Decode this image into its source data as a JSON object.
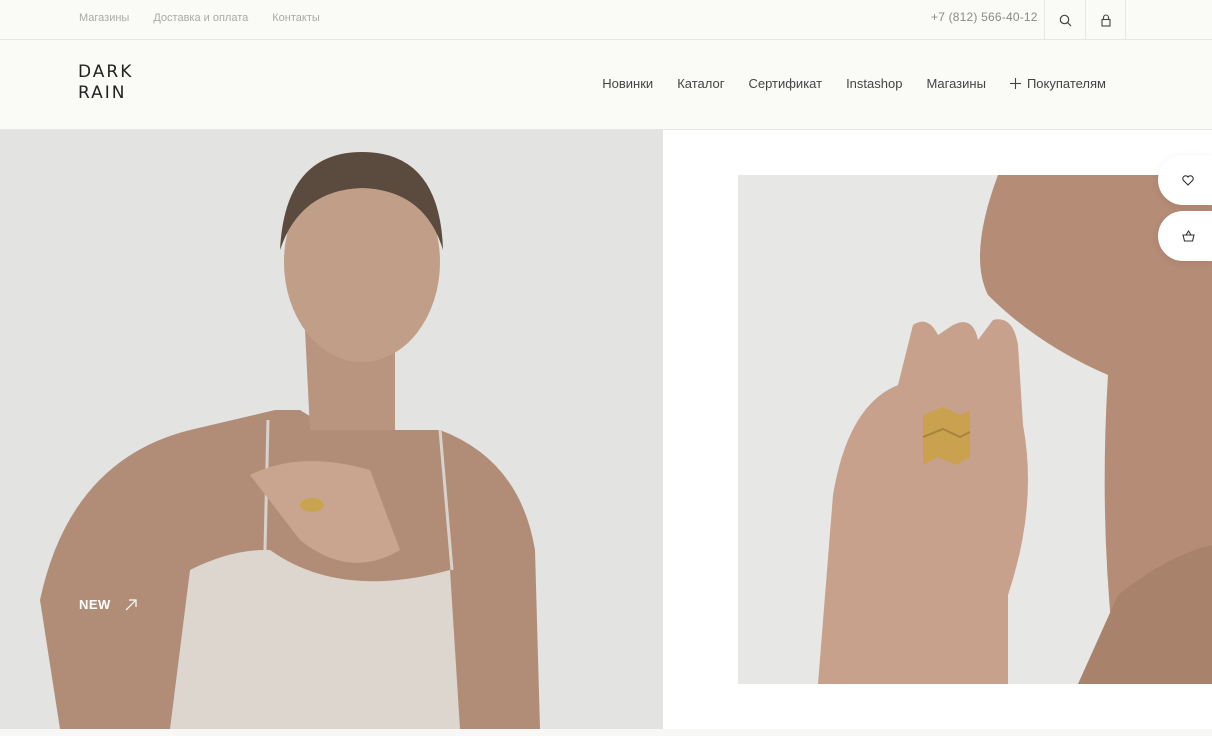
{
  "topbar": {
    "links": [
      "Магазины",
      "Доставка и оплата",
      "Контакты"
    ],
    "phone": "+7 (812) 566-40-12",
    "icons": {
      "search": "search-icon",
      "account": "user-icon"
    }
  },
  "header": {
    "logo": {
      "line1": "DARK",
      "line2": "RAIN"
    },
    "nav": [
      "Новинки",
      "Каталог",
      "Сертификат",
      "Instashop",
      "Магазины",
      "Покупателям"
    ]
  },
  "hero": {
    "left_link": "NEW",
    "left_link_icon": "arrow-up-right-icon"
  },
  "floating": {
    "favorites_icon": "heart-icon",
    "cart_icon": "basket-icon"
  },
  "colors": {
    "background": "#fafaf7",
    "border": "#e6e6e2",
    "text": "#444444",
    "muted": "#a9a9a6"
  }
}
